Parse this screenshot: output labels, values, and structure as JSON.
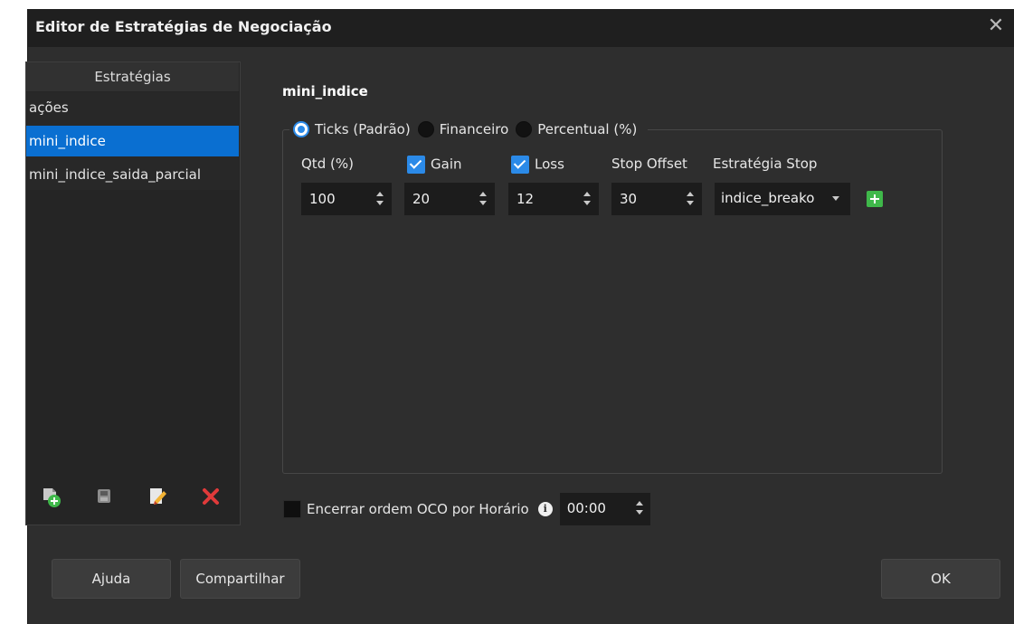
{
  "window": {
    "title": "Editor de Estratégias de Negociação",
    "close_glyph": "✕"
  },
  "sidebar": {
    "header": "Estratégias",
    "items": [
      {
        "label": "ações",
        "selected": false
      },
      {
        "label": "mini_indice",
        "selected": true
      },
      {
        "label": "mini_indice_saida_parcial",
        "selected": false
      }
    ],
    "toolbar": [
      {
        "icon": "new-strategy-icon"
      },
      {
        "icon": "save-icon"
      },
      {
        "icon": "edit-icon"
      },
      {
        "icon": "delete-icon"
      }
    ]
  },
  "editor": {
    "strategy_name": "mini_indice",
    "mode_options": [
      {
        "label": "Ticks (Padrão)",
        "checked": true
      },
      {
        "label": "Financeiro",
        "checked": false
      },
      {
        "label": "Percentual (%)",
        "checked": false
      }
    ],
    "labels": {
      "qtd": "Qtd (%)",
      "gain": "Gain",
      "loss": "Loss",
      "stop_offset": "Stop Offset",
      "stop_strategy": "Estratégia Stop"
    },
    "gain_checked": true,
    "loss_checked": true,
    "values": {
      "qtd": "100",
      "gain": "20",
      "loss": "12",
      "stop_offset": "30",
      "stop_strategy": "indice_breako"
    },
    "oco": {
      "label": "Encerrar ordem OCO por Horário",
      "checked": false,
      "time": "00:00"
    }
  },
  "buttons": {
    "help": "Ajuda",
    "share": "Compartilhar",
    "ok": "OK"
  },
  "colors": {
    "background": "#2e2e2e",
    "titlebar": "#1f1f1f",
    "accent": "#2b8ae8",
    "selection": "#0a6fd1",
    "add_green": "#3fb84a",
    "delete_red": "#e03a3a"
  }
}
